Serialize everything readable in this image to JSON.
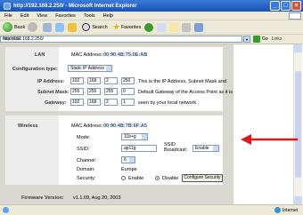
{
  "window": {
    "title": "http://192.168.2.250/ - Microsoft Internet Explorer"
  },
  "menu": [
    "File",
    "Edit",
    "View",
    "Favorites",
    "Tools",
    "Help"
  ],
  "toolbar": {
    "back": "Back",
    "search": "Search",
    "favorites": "Favorites"
  },
  "address": {
    "label": "Address",
    "url": "http://192.168.2.250/",
    "go": "Go",
    "links": "Links"
  },
  "lan": {
    "section": "LAN",
    "mac_label": "MAC Address:",
    "mac": "00:90:4B:75:0E:AB",
    "config_label": "Configuration type:",
    "config_value": "Static IP Address",
    "ip_label": "IP Address:",
    "ip": [
      "192",
      "168",
      "2",
      "250"
    ],
    "mask_label": "Subnet Mask:",
    "mask": [
      "255",
      "255",
      "255",
      "0"
    ],
    "gw_label": "Gateway:",
    "gw": [
      "192",
      "168",
      "2",
      "1"
    ],
    "note1": "This is the IP Address, Subnet Mask and",
    "note2": "Default Gateway of the Access Point as it is",
    "note3": "seen by your local network."
  },
  "wireless": {
    "section": "Wireless",
    "mac_label": "MAC Address:",
    "mac": "00:90:4B:7B:6F:A5",
    "mode_label": "Mode:",
    "mode": "11b+g",
    "ssid_label": "SSID:",
    "ssid": "ap11g",
    "broadcast_label": "SSID Broadcast:",
    "broadcast": "Enable",
    "channel_label": "Channel:",
    "channel": "6",
    "domain_label": "Domain:",
    "domain": "Europe",
    "security_label": "Security:",
    "enable": "Enable",
    "disable": "Disable",
    "configure": "Configure Security"
  },
  "firmware": {
    "label": "Firmware Version:",
    "value": "v1.1.09, Aug 20, 2003"
  },
  "status": {
    "zone": "Internet"
  },
  "colors": {
    "arrow": "#e3151a",
    "accent": "#1650b8"
  }
}
